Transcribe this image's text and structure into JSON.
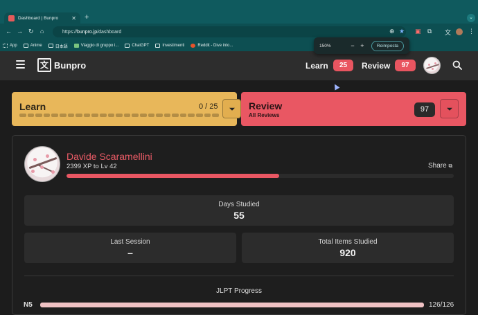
{
  "browser": {
    "tab_title": "Dashboard | Bunpro",
    "url_prefix": "https://",
    "url_host": "bunpro.jp",
    "url_path": "/dashboard",
    "bookmarks": [
      {
        "label": "App",
        "icon": "apps-grid-icon"
      },
      {
        "label": "Anime",
        "icon": "folder-icon"
      },
      {
        "label": "日本語",
        "icon": "folder-icon"
      },
      {
        "label": "Viaggio di gruppo i...",
        "icon": "leaf-icon"
      },
      {
        "label": "ChatGPT",
        "icon": "chatgpt-icon"
      },
      {
        "label": "Investimenti",
        "icon": "folder-icon"
      },
      {
        "label": "Reddit - Dive into...",
        "icon": "reddit-icon"
      }
    ],
    "zoom": {
      "level": "150%",
      "minus": "−",
      "plus": "+",
      "reset_label": "Reimposta"
    }
  },
  "nav": {
    "brand": "Bunpro",
    "logo_glyph": "文",
    "learn_label": "Learn",
    "learn_count": "25",
    "review_label": "Review",
    "review_count": "97"
  },
  "learn_card": {
    "label": "Learn",
    "progress_text": "0 / 25",
    "done": 0,
    "total": 25
  },
  "review_card": {
    "label": "Review",
    "sublabel": "All Reviews",
    "count": "97"
  },
  "profile": {
    "name": "Davide Scaramellini",
    "xp_text": "2399 XP to Lv 42",
    "share_label": "Share",
    "xp_progress": 0.55
  },
  "stats": {
    "days_studied_label": "Days Studied",
    "days_studied_value": "55",
    "last_session_label": "Last Session",
    "last_session_value": "–",
    "total_items_label": "Total Items Studied",
    "total_items_value": "920"
  },
  "jlpt": {
    "title": "JLPT Progress",
    "levels": [
      {
        "level": "N5",
        "count": "126/126",
        "progress": 1.0
      }
    ]
  },
  "colors": {
    "learn": "#e8b75a",
    "review": "#e95763",
    "accent_name": "#ea5b66",
    "browser_chrome": "#0d4f52"
  }
}
